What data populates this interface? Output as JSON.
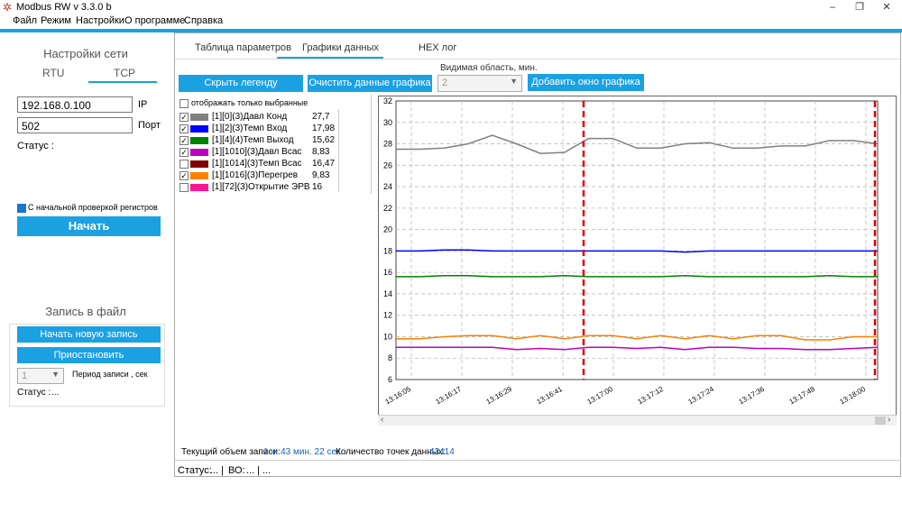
{
  "window": {
    "title": "Modbus RW v 3.3.0 b",
    "minimize": "–",
    "maximize": "❐",
    "close": "✕"
  },
  "menu": [
    "Файл",
    "Режим",
    "Настройки",
    "О программе",
    "Справка"
  ],
  "network": {
    "title": "Настройки сети",
    "tabs": [
      "RTU",
      "TCP"
    ],
    "active_tab": "TCP",
    "ip_value": "192.168.0.100",
    "ip_label": "IP",
    "port_value": "502",
    "port_label": "Порт",
    "status_label": "Статус :",
    "precheck_label": "С начальной проверкой регистров",
    "precheck_checked": true,
    "start_button": "Начать"
  },
  "file_record": {
    "title": "Запись в файл",
    "new_record_button": "Начать новую запись",
    "pause_button": "Приостановить",
    "period_value": "1",
    "period_label": "Период записи , сек",
    "status_label": "Статус :",
    "status_value": "..."
  },
  "main_tabs": [
    "Таблица параметров",
    "Графики данных",
    "HEX лог"
  ],
  "active_main_tab": "Графики данных",
  "toolbar": {
    "hide_legend": "Скрыть легенду",
    "clear_chart": "Очистить данные графика",
    "visible_area_label": "Видимая область, мин.",
    "visible_area_value": "2",
    "add_chart_window": "Добавить окно графика"
  },
  "legend": {
    "only_selected_label": "отображать только выбранные",
    "items": [
      {
        "checked": true,
        "color": "#808080",
        "name": "[1][0](3)Давл Конд",
        "value": "27,7"
      },
      {
        "checked": true,
        "color": "#0000ff",
        "name": "[1][2](3)Темп Вход",
        "value": "17,98"
      },
      {
        "checked": true,
        "color": "#008000",
        "name": "[1][4](4)Темп Выход",
        "value": "15,62"
      },
      {
        "checked": true,
        "color": "#c000c0",
        "name": "[1][1010](3)Давл Всас",
        "value": "8,83"
      },
      {
        "checked": false,
        "color": "#800000",
        "name": "[1][1014](3)Темп Всас",
        "value": "16,47"
      },
      {
        "checked": true,
        "color": "#ff8000",
        "name": "[1][1016](3)Перегрев",
        "value": "9,83"
      },
      {
        "checked": false,
        "color": "#ff1493",
        "name": "[1][72](3)Открытие ЭРВ",
        "value": "16"
      }
    ]
  },
  "chart_data": {
    "type": "line",
    "x": [
      "13:16:05",
      "13:16:17",
      "13:16:29",
      "13:16:41",
      "13:17:00",
      "13:17:12",
      "13:17:24",
      "13:17:36",
      "13:17:48",
      "13:18:00"
    ],
    "ylim": [
      6,
      32
    ],
    "yticks": [
      6,
      8,
      10,
      12,
      14,
      16,
      18,
      20,
      22,
      24,
      26,
      28,
      30,
      32
    ],
    "grid": true,
    "markers_color": "#e00000",
    "series": [
      {
        "name": "[1][0](3)Давл Конд",
        "color": "#808080",
        "values": [
          27.5,
          27.5,
          27.6,
          28.0,
          28.8,
          28.0,
          27.1,
          27.2,
          28.5,
          28.5,
          27.6,
          27.6,
          28.0,
          28.1,
          27.6,
          27.6,
          27.8,
          27.8,
          28.3,
          28.3,
          28.0
        ]
      },
      {
        "name": "[1][2](3)Темп Вход",
        "color": "#0000ff",
        "values": [
          18.0,
          18.0,
          18.1,
          18.1,
          18.0,
          18.0,
          18.0,
          18.0,
          18.0,
          18.0,
          18.0,
          18.0,
          17.9,
          18.0,
          18.0,
          18.0,
          18.0,
          18.0,
          18.0,
          18.0,
          18.0
        ]
      },
      {
        "name": "[1][4](4)Темп Выход",
        "color": "#008000",
        "values": [
          15.6,
          15.6,
          15.7,
          15.7,
          15.6,
          15.6,
          15.6,
          15.7,
          15.6,
          15.6,
          15.6,
          15.6,
          15.7,
          15.6,
          15.6,
          15.6,
          15.6,
          15.6,
          15.7,
          15.6,
          15.6
        ]
      },
      {
        "name": "[1][1016](3)Перегрев",
        "color": "#ff8000",
        "values": [
          9.8,
          9.8,
          10.0,
          10.1,
          10.1,
          9.8,
          10.1,
          9.8,
          10.1,
          10.1,
          9.8,
          10.1,
          9.8,
          10.1,
          9.8,
          10.1,
          10.1,
          9.7,
          9.7,
          10.0,
          10.0
        ]
      },
      {
        "name": "[1][1010](3)Давл Всас",
        "color": "#c000c0",
        "values": [
          9.0,
          9.0,
          9.0,
          9.0,
          9.0,
          8.8,
          8.9,
          8.8,
          9.0,
          9.0,
          8.9,
          9.0,
          8.8,
          9.0,
          9.0,
          8.9,
          8.9,
          8.8,
          8.8,
          8.9,
          9.0
        ]
      }
    ]
  },
  "footer": {
    "record_volume_label": "Текущий объем записи:",
    "record_volume_value": "1 ч. 43 мин. 22 сек.",
    "points_label": "Количество точек данных:",
    "points_value": "43414"
  },
  "statusbar": {
    "status_label": "Статус:",
    "status_value": "...",
    "sep": "|",
    "bo_label": "ВО:",
    "bo_value": "..."
  }
}
